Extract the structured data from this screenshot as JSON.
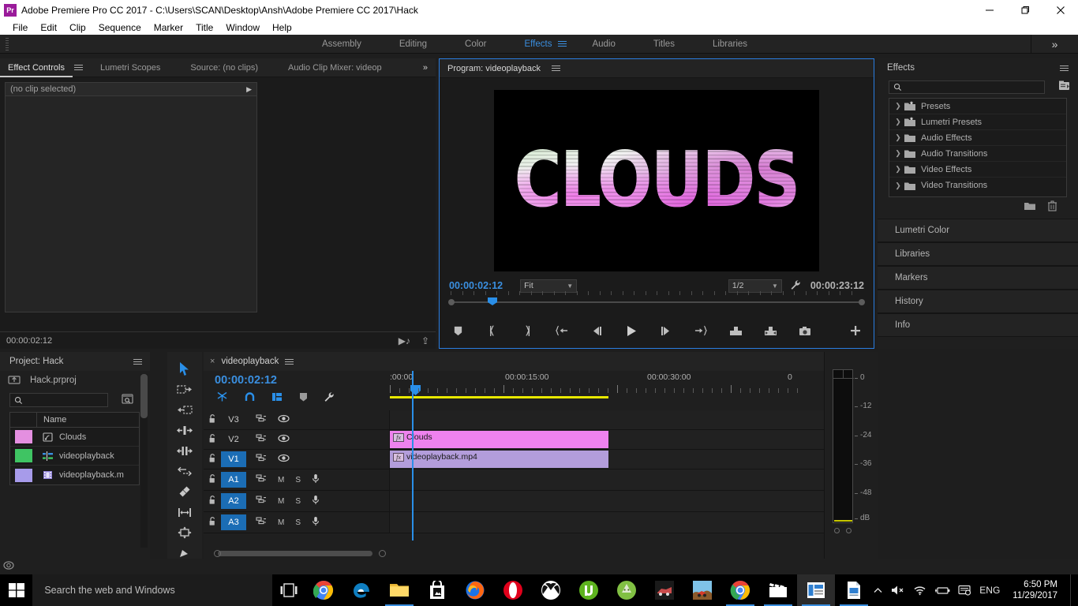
{
  "window": {
    "app_icon": "Pr",
    "title": "Adobe Premiere Pro CC 2017 - C:\\Users\\SCAN\\Desktop\\Ansh\\Adobe Premiere CC 2017\\Hack",
    "minimize": "minimize-icon",
    "maximize": "maximize-icon",
    "close": "close-icon"
  },
  "menubar": {
    "items": [
      "File",
      "Edit",
      "Clip",
      "Sequence",
      "Marker",
      "Title",
      "Window",
      "Help"
    ]
  },
  "workspace": {
    "tabs": [
      {
        "label": "Assembly",
        "active": false
      },
      {
        "label": "Editing",
        "active": false
      },
      {
        "label": "Color",
        "active": false
      },
      {
        "label": "Effects",
        "active": true
      },
      {
        "label": "Audio",
        "active": false
      },
      {
        "label": "Titles",
        "active": false
      },
      {
        "label": "Libraries",
        "active": false
      }
    ],
    "overflow": "»"
  },
  "effect_controls": {
    "tabs": [
      {
        "label": "Effect Controls",
        "active": true
      },
      {
        "label": "Lumetri Scopes",
        "active": false
      },
      {
        "label": "Source: (no clips)",
        "active": false
      },
      {
        "label": "Audio Clip Mixer: videop",
        "active": false
      }
    ],
    "overflow": "»",
    "clip_selection": "(no clip selected)",
    "footer_timecode": "00:00:02:12"
  },
  "program_monitor": {
    "tab_label": "Program: videoplayback",
    "video_text": "CLOUDS",
    "current_timecode": "00:00:02:12",
    "fit_label": "Fit",
    "resolution_label": "1/2",
    "duration_timecode": "00:00:23:12",
    "transport_buttons": [
      "add-marker-icon",
      "mark-in-icon",
      "mark-out-icon",
      "go-to-in-icon",
      "step-back-icon",
      "play-icon",
      "step-forward-icon",
      "go-to-out-icon",
      "lift-icon",
      "extract-icon",
      "export-frame-icon",
      "button-editor-icon"
    ]
  },
  "effects_panel": {
    "title": "Effects",
    "search_placeholder": "",
    "search_value": "",
    "items": [
      {
        "label": "Presets",
        "icon": "preset-folder-icon"
      },
      {
        "label": "Lumetri Presets",
        "icon": "preset-folder-icon"
      },
      {
        "label": "Audio Effects",
        "icon": "folder-icon"
      },
      {
        "label": "Audio Transitions",
        "icon": "folder-icon"
      },
      {
        "label": "Video Effects",
        "icon": "folder-icon"
      },
      {
        "label": "Video Transitions",
        "icon": "folder-icon"
      }
    ],
    "collapsed_panels": [
      "Lumetri Color",
      "Libraries",
      "Markers",
      "History",
      "Info"
    ]
  },
  "project_panel": {
    "title": "Project: Hack",
    "breadcrumb": "Hack.prproj",
    "search_value": "",
    "column_header": "Name",
    "rows": [
      {
        "name": "Clouds",
        "swatch": "#e48fe0",
        "icon": "title-icon"
      },
      {
        "name": "videoplayback",
        "swatch": "#3fc463",
        "icon": "sequence-icon"
      },
      {
        "name": "videoplayback.m",
        "swatch": "#a79bea",
        "icon": "film-icon"
      }
    ]
  },
  "tools": [
    {
      "name": "selection-tool",
      "active": true
    },
    {
      "name": "track-select-forward-tool",
      "active": false
    },
    {
      "name": "track-select-backward-tool",
      "active": false
    },
    {
      "name": "ripple-edit-tool",
      "active": false
    },
    {
      "name": "rolling-edit-tool",
      "active": false
    },
    {
      "name": "rate-stretch-tool",
      "active": false
    },
    {
      "name": "razor-tool",
      "active": false
    },
    {
      "name": "slip-tool",
      "active": false
    },
    {
      "name": "slide-tool",
      "active": false
    },
    {
      "name": "pen-tool",
      "active": false
    }
  ],
  "timeline": {
    "tab_label": "videoplayback",
    "current_timecode": "00:00:02:12",
    "header_icons": [
      "nest-sequence-icon",
      "snap-icon",
      "linked-selection-icon",
      "add-marker-icon",
      "timeline-settings-icon"
    ],
    "ruler_labels": [
      ":00:00",
      "00:00:15:00",
      "00:00:30:00",
      "0"
    ],
    "tracks": [
      {
        "name": "V3",
        "type": "video",
        "enabled": false,
        "clip": null
      },
      {
        "name": "V2",
        "type": "video",
        "enabled": false,
        "clip": {
          "label": "Clouds",
          "color": "#ee82ee",
          "fx": "fx"
        }
      },
      {
        "name": "V1",
        "type": "video",
        "enabled": true,
        "clip": {
          "label": "videoplayback.mp4",
          "color": "#b39ddb",
          "fx": "fx"
        }
      },
      {
        "name": "A1",
        "type": "audio",
        "enabled": true,
        "clip": null,
        "mute": "M",
        "solo": "S",
        "rec": "mic-icon"
      },
      {
        "name": "A2",
        "type": "audio",
        "enabled": true,
        "clip": null,
        "mute": "M",
        "solo": "S",
        "rec": "mic-icon"
      },
      {
        "name": "A3",
        "type": "audio",
        "enabled": true,
        "clip": null,
        "mute": "M",
        "solo": "S",
        "rec": "mic-icon"
      }
    ]
  },
  "audio_meter": {
    "scale_labels": [
      "0",
      "-12",
      "-24",
      "-36",
      "-48",
      "dB"
    ]
  },
  "taskbar": {
    "start": "windows-start-icon",
    "search_placeholder": "Search the web and Windows",
    "task_view": "task-view-icon",
    "apps": [
      {
        "name": "chrome-icon",
        "running": false
      },
      {
        "name": "edge-icon",
        "running": false
      },
      {
        "name": "file-explorer-icon",
        "running": true
      },
      {
        "name": "store-icon",
        "running": false
      },
      {
        "name": "firefox-icon",
        "running": false
      },
      {
        "name": "opera-icon",
        "running": false
      },
      {
        "name": "xbox-icon",
        "running": false
      },
      {
        "name": "utorrent-icon",
        "running": false
      },
      {
        "name": "android-studio-icon",
        "running": false
      },
      {
        "name": "asphalt-game-icon",
        "running": false
      },
      {
        "name": "hill-climb-icon",
        "running": false
      },
      {
        "name": "chrome-window-icon",
        "running": true
      },
      {
        "name": "premiere-media-icon",
        "running": true
      },
      {
        "name": "premiere-pro-icon",
        "running": true,
        "active": true
      },
      {
        "name": "document-icon",
        "running": true
      }
    ],
    "tray": {
      "chevron": "show-hidden-icons",
      "volume": "volume-muted-icon",
      "network": "wifi-icon",
      "battery": "battery-icon",
      "action_center": "action-center-icon",
      "language": "ENG"
    },
    "clock": {
      "time": "6:50 PM",
      "date": "11/29/2017"
    }
  },
  "colors": {
    "accent_blue": "#3a8fe0",
    "clip_v2": "#ee82ee",
    "clip_v1": "#b39ddb",
    "work_area_yellow": "#e8e800"
  }
}
